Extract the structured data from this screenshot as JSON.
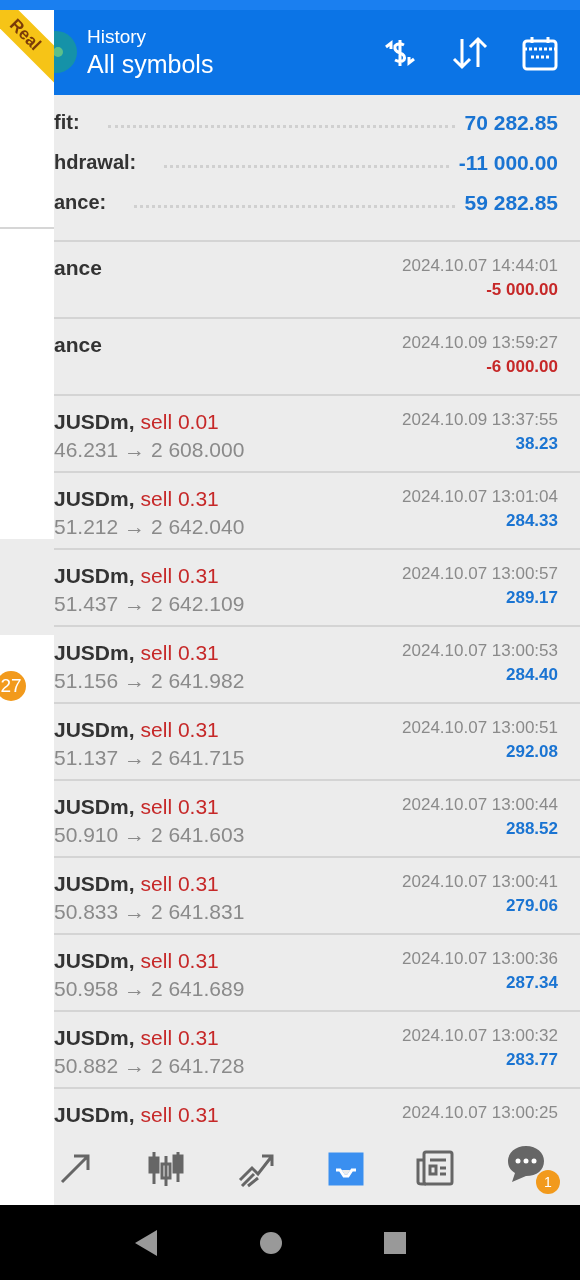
{
  "account_ribbon": "Real",
  "side_panel": {
    "highlighted": true,
    "badge": "27"
  },
  "header": {
    "subtitle": "History",
    "title": "All symbols"
  },
  "summary": [
    {
      "label": "fit:",
      "value": "70 282.85"
    },
    {
      "label": "hdrawal:",
      "value": "-11 000.00"
    },
    {
      "label": "ance:",
      "value": "59 282.85"
    }
  ],
  "rows": [
    {
      "kind": "balance",
      "name": "ance",
      "time": "2024.10.07 14:44:01",
      "amount": "-5 000.00",
      "negative": true
    },
    {
      "kind": "balance",
      "name": "ance",
      "time": "2024.10.09 13:59:27",
      "amount": "-6 000.00",
      "negative": true
    },
    {
      "kind": "trade",
      "symbol": "JUSDm,",
      "side": "sell 0.01",
      "prices": "46.231 → 2 608.000",
      "time": "2024.10.09 13:37:55",
      "amount": "38.23",
      "negative": false
    },
    {
      "kind": "trade",
      "symbol": "JUSDm,",
      "side": "sell 0.31",
      "prices": "51.212 → 2 642.040",
      "time": "2024.10.07 13:01:04",
      "amount": "284.33",
      "negative": false
    },
    {
      "kind": "trade",
      "symbol": "JUSDm,",
      "side": "sell 0.31",
      "prices": "51.437 → 2 642.109",
      "time": "2024.10.07 13:00:57",
      "amount": "289.17",
      "negative": false
    },
    {
      "kind": "trade",
      "symbol": "JUSDm,",
      "side": "sell 0.31",
      "prices": "51.156 → 2 641.982",
      "time": "2024.10.07 13:00:53",
      "amount": "284.40",
      "negative": false
    },
    {
      "kind": "trade",
      "symbol": "JUSDm,",
      "side": "sell 0.31",
      "prices": "51.137 → 2 641.715",
      "time": "2024.10.07 13:00:51",
      "amount": "292.08",
      "negative": false
    },
    {
      "kind": "trade",
      "symbol": "JUSDm,",
      "side": "sell 0.31",
      "prices": "50.910 → 2 641.603",
      "time": "2024.10.07 13:00:44",
      "amount": "288.52",
      "negative": false
    },
    {
      "kind": "trade",
      "symbol": "JUSDm,",
      "side": "sell 0.31",
      "prices": "50.833 → 2 641.831",
      "time": "2024.10.07 13:00:41",
      "amount": "279.06",
      "negative": false
    },
    {
      "kind": "trade",
      "symbol": "JUSDm,",
      "side": "sell 0.31",
      "prices": "50.958 → 2 641.689",
      "time": "2024.10.07 13:00:36",
      "amount": "287.34",
      "negative": false
    },
    {
      "kind": "trade",
      "symbol": "JUSDm,",
      "side": "sell 0.31",
      "prices": "50.882 → 2 641.728",
      "time": "2024.10.07 13:00:32",
      "amount": "283.77",
      "negative": false
    },
    {
      "kind": "trade",
      "symbol": "JUSDm,",
      "side": "sell 0.31",
      "time": "2024.10.07 13:00:25"
    }
  ],
  "bottom_nav": [
    {
      "selected": false
    },
    {
      "selected": false
    },
    {
      "selected": false
    },
    {
      "selected": true
    },
    {
      "selected": false
    },
    {
      "selected": false,
      "badge": "1"
    }
  ]
}
